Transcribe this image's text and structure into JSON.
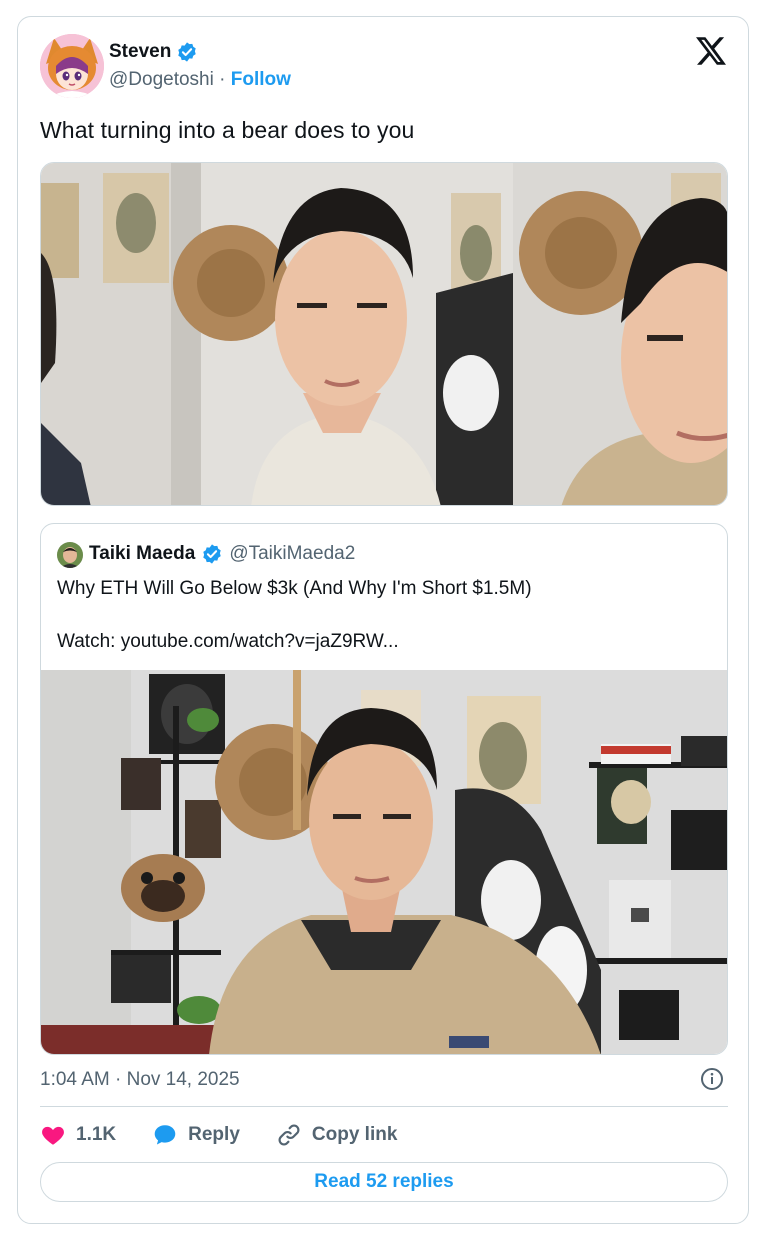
{
  "author": {
    "name": "Steven",
    "handle": "@Dogetoshi",
    "separator": "·",
    "follow_label": "Follow"
  },
  "tweet": {
    "text": "What turning into a bear does to you"
  },
  "quoted": {
    "name": "Taiki Maeda",
    "handle": "@TaikiMaeda2",
    "line1": "Why ETH Will Go Below $3k (And Why I'm Short $1.5M)",
    "line2": "Watch: youtube.com/watch?v=jaZ9RW..."
  },
  "meta": {
    "timestamp": "1:04 AM · Nov 14, 2025"
  },
  "actions": {
    "like_count": "1.1K",
    "reply_label": "Reply",
    "copy_label": "Copy link"
  },
  "read_replies_label": "Read 52 replies",
  "colors": {
    "accent": "#1d9bf0",
    "like": "#f91880",
    "border": "#cfd9de",
    "muted": "#536471"
  },
  "icons": {
    "platform": "x-logo-icon",
    "verified": "verified-badge-icon",
    "like": "heart-icon",
    "reply": "speech-bubble-icon",
    "copy": "link-icon",
    "info": "info-icon"
  }
}
